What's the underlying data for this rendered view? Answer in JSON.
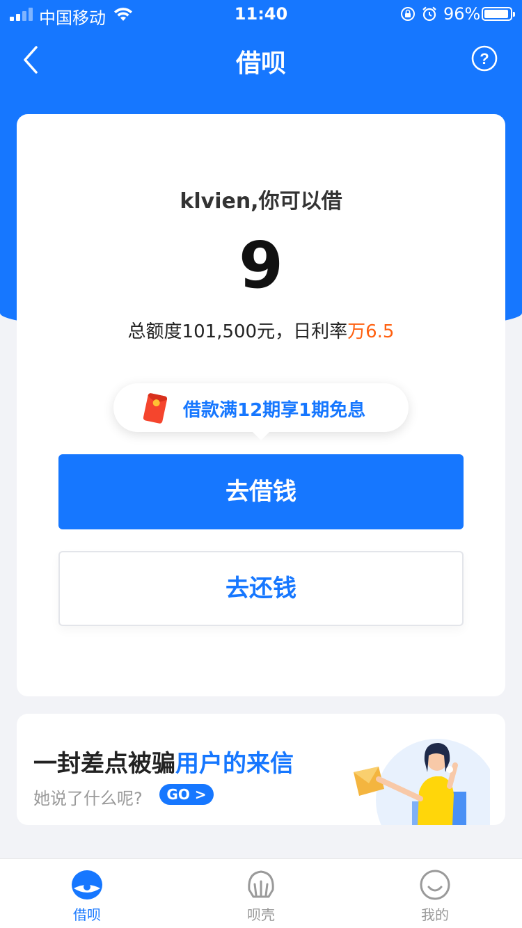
{
  "status_bar": {
    "carrier": "中国移动",
    "time": "11:40",
    "battery": "96%"
  },
  "nav": {
    "title": "借呗",
    "back_icon": "chevron-left-icon",
    "help_icon": "question-circle-icon"
  },
  "card": {
    "greeting": "klvien,你可以借",
    "amount": "9",
    "limit_prefix": "总额度101,500元，日利率",
    "rate": "万6.5",
    "promo": "借款满12期享1期免息",
    "borrow_label": "去借钱",
    "repay_label": "去还钱"
  },
  "banner": {
    "title_part1": "一封差点被骗",
    "title_part2": "用户的来信",
    "subtitle": "她说了什么呢?",
    "go_label": "GO >"
  },
  "tabs": [
    {
      "label": "借呗",
      "icon": "jiebei-icon",
      "active": true
    },
    {
      "label": "呗壳",
      "icon": "shell-icon",
      "active": false
    },
    {
      "label": "我的",
      "icon": "smile-icon",
      "active": false
    }
  ],
  "colors": {
    "primary": "#1677ff",
    "rate": "#ff6010",
    "background": "#f2f3f7"
  }
}
